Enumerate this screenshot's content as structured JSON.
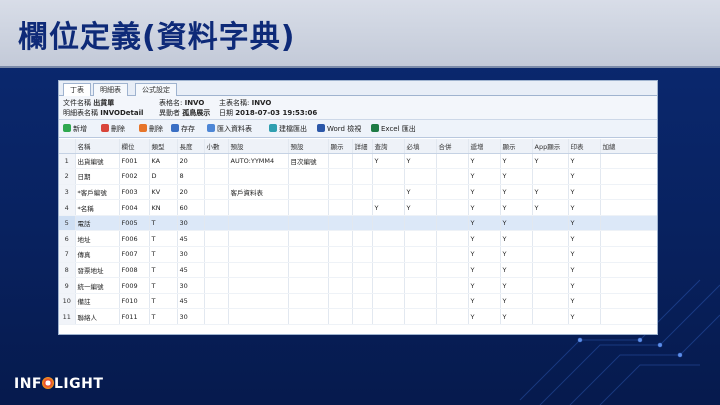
{
  "slide": {
    "title": "欄位定義(資料字典)"
  },
  "tabs": [
    {
      "label": "丁表"
    },
    {
      "label": "明細表"
    },
    {
      "label": "公式設定"
    }
  ],
  "form": {
    "file_name_label": "文件名稱",
    "file_name_value": "出貨單",
    "table_name_label": "表格名:",
    "table_name_value": "INVO",
    "master_label": "主表名稱:",
    "master_value": "INVO",
    "detail_label": "明細表名稱",
    "detail_value": "INVODetail",
    "author_label": "異動者",
    "author_value": "孤鳥展示",
    "date_label": "日期",
    "date_value": "2018-07-03 19:53:06"
  },
  "toolbar": {
    "buttons": [
      {
        "label": "新增",
        "icon": "add-icon"
      },
      {
        "label": "刪除",
        "icon": "delete-icon"
      },
      {
        "label": "刪除",
        "icon": "remove-icon"
      },
      {
        "label": "存存",
        "icon": "save-icon"
      },
      {
        "label": "匯入資料表",
        "icon": "import-icon"
      },
      {
        "label": "建檔匯出",
        "icon": "export-icon"
      },
      {
        "label": "Word 檢視",
        "icon": "word-icon"
      },
      {
        "label": "Excel 匯出",
        "icon": "excel-icon"
      }
    ]
  },
  "grid": {
    "columns": [
      "名稱",
      "欄位",
      "類型",
      "長度",
      "小數",
      "預設",
      "預設",
      "顯示",
      "詳細",
      "查詢",
      "必填",
      "合併",
      "遞增",
      "顯示",
      "App顯示",
      "印表",
      "加總"
    ],
    "rows": [
      [
        "1",
        "出貨編號",
        "F001",
        "KA",
        "20",
        "",
        "AUTO:YYMM4",
        "目次編號",
        "",
        "",
        "Y",
        "Y",
        "",
        "Y",
        "Y",
        "Y",
        "Y",
        ""
      ],
      [
        "2",
        "日期",
        "F002",
        "D",
        "8",
        "",
        "",
        "",
        "",
        "",
        "",
        "",
        "",
        "Y",
        "Y",
        "",
        "Y",
        ""
      ],
      [
        "3",
        "*客戶編號",
        "F003",
        "KV",
        "20",
        "",
        "客戶資料表",
        "",
        "",
        "",
        "",
        "Y",
        "",
        "Y",
        "Y",
        "Y",
        "Y",
        ""
      ],
      [
        "4",
        "*名稱",
        "F004",
        "KN",
        "60",
        "",
        "",
        "",
        "",
        "",
        "Y",
        "Y",
        "",
        "Y",
        "Y",
        "Y",
        "Y",
        ""
      ],
      [
        "5",
        "電話",
        "F005",
        "T",
        "30",
        "",
        "",
        "",
        "",
        "",
        "",
        "",
        "",
        "Y",
        "Y",
        "",
        "Y",
        ""
      ],
      [
        "6",
        "地址",
        "F006",
        "T",
        "45",
        "",
        "",
        "",
        "",
        "",
        "",
        "",
        "",
        "Y",
        "Y",
        "",
        "Y",
        ""
      ],
      [
        "7",
        "傳真",
        "F007",
        "T",
        "30",
        "",
        "",
        "",
        "",
        "",
        "",
        "",
        "",
        "Y",
        "Y",
        "",
        "Y",
        ""
      ],
      [
        "8",
        "發票地址",
        "F008",
        "T",
        "45",
        "",
        "",
        "",
        "",
        "",
        "",
        "",
        "",
        "Y",
        "Y",
        "",
        "Y",
        ""
      ],
      [
        "9",
        "統一編號",
        "F009",
        "T",
        "30",
        "",
        "",
        "",
        "",
        "",
        "",
        "",
        "",
        "Y",
        "Y",
        "",
        "Y",
        ""
      ],
      [
        "10",
        "備註",
        "F010",
        "T",
        "45",
        "",
        "",
        "",
        "",
        "",
        "",
        "",
        "",
        "Y",
        "Y",
        "",
        "Y",
        ""
      ],
      [
        "11",
        "聯絡人",
        "F011",
        "T",
        "30",
        "",
        "",
        "",
        "",
        "",
        "",
        "",
        "",
        "Y",
        "Y",
        "",
        "Y",
        ""
      ]
    ],
    "selected_row": 4
  },
  "logo": {
    "text_a": "INF",
    "text_b": "LIGHT"
  },
  "colors": {
    "title": "#0e2a78",
    "background": "#0b2a73",
    "selected_row": "#dce8f8"
  }
}
